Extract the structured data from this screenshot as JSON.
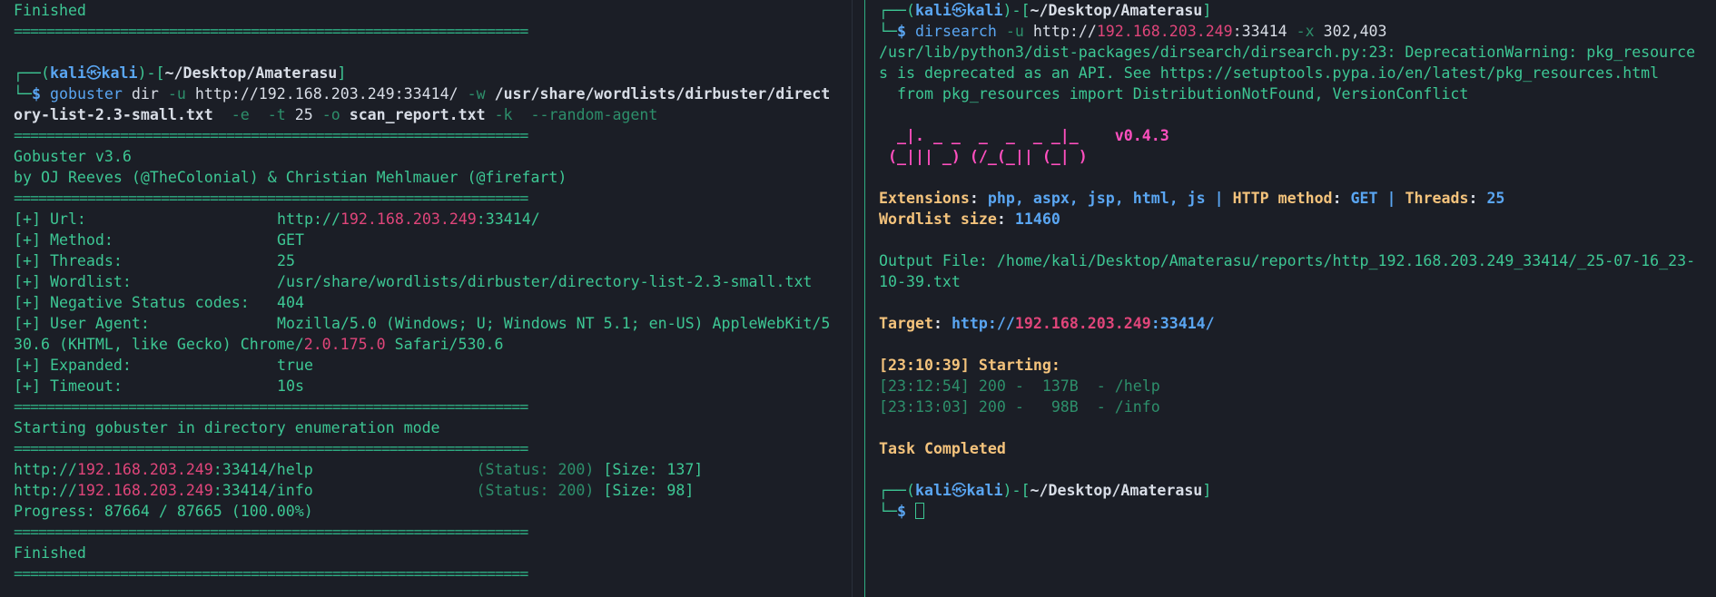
{
  "left": {
    "top_finished": "Finished",
    "separator": "===============================================================",
    "prompt": {
      "user": "kali",
      "host": "kali",
      "symbol": "㉿",
      "path": "~/Desktop/Amaterasu"
    },
    "command": {
      "tool": "gobuster",
      "sub": "dir",
      "u_flag": "-u",
      "url": "http://192.168.203.249:33414/",
      "w_flag": "-w",
      "wordlist_part1": "/usr/share/wordlists/dirbuster/direct",
      "wordlist_part2": "ory-list-2.3-small.txt",
      "e_flag": "-e",
      "t_flag": "-t",
      "t_value": "25",
      "o_flag": "-o",
      "output": "scan_report.txt",
      "k_flag": "-k",
      "random_agent": "--random-agent"
    },
    "banner_1": "Gobuster v3.6",
    "banner_2": "by OJ Reeves (@TheColonial) & Christian Mehlmauer (@firefart)",
    "config": {
      "url_label": "[+] Url:",
      "url_prefix": "http://",
      "url_ip": "192.168.203.249",
      "url_suffix": ":33414/",
      "method_label": "[+] Method:",
      "method_value": "GET",
      "threads_label": "[+] Threads:",
      "threads_value": "25",
      "wordlist_label": "[+] Wordlist:",
      "wordlist_value": "/usr/share/wordlists/dirbuster/directory-list-2.3-small.txt",
      "negative_label": "[+] Negative Status codes:",
      "negative_value": "404",
      "ua_label": "[+] User Agent:",
      "ua_value_1": "Mozilla/5.0 (Windows; U; Windows NT 5.1; en-US) AppleWebKit/5",
      "ua_value_2a": "30.6 (KHTML, like Gecko) Chrome/",
      "ua_value_2b": "2.0.175.0",
      "ua_value_2c": " Safari/530.6",
      "expanded_label": "[+] Expanded:",
      "expanded_value": "true",
      "timeout_label": "[+] Timeout:",
      "timeout_value": "10s"
    },
    "starting_text": "Starting gobuster in directory enumeration mode",
    "results": [
      {
        "prefix": "http://",
        "ip": "192.168.203.249",
        "path": ":33414/help",
        "status": "(Status: 200)",
        "size": "[Size: 137]"
      },
      {
        "prefix": "http://",
        "ip": "192.168.203.249",
        "path": ":33414/info",
        "status": "(Status: 200)",
        "size": "[Size: 98]"
      }
    ],
    "progress": "Progress: 87664 / 87665 (100.00%)",
    "bottom_finished": "Finished"
  },
  "right": {
    "prompt": {
      "user": "kali",
      "host": "kali",
      "symbol": "㉿",
      "path": "~/Desktop/Amaterasu"
    },
    "command": {
      "tool": "dirsearch",
      "u_flag": "-u",
      "url_prefix": "http://",
      "ip": "192.168.203.249",
      "url_suffix": ":33414",
      "x_flag": "-x",
      "x_value": "302,403"
    },
    "warning_1": "/usr/lib/python3/dist-packages/dirsearch/dirsearch.py:23: DeprecationWarning: pkg_resource",
    "warning_2": "s is deprecated as an API. See https://setuptools.pypa.io/en/latest/pkg_resources.html",
    "warning_3": "  from pkg_resources import DistributionNotFound, VersionConflict",
    "logo_1": "  _|. _ _  _  _  _ _|_",
    "logo_2": " (_||| _) (/_(_|| (_| )",
    "version": "v0.4.3",
    "ext_label": "Extensions",
    "ext_value": "php, aspx, jsp, html, js",
    "method_label": "HTTP method",
    "method_value": "GET",
    "threads_label": "Threads",
    "threads_value": "25",
    "wordlist_label": "Wordlist size",
    "wordlist_value": "11460",
    "output_line_1": "Output File: /home/kali/Desktop/Amaterasu/reports/http_192.168.203.249_33414/_25-07-16_23-",
    "output_line_2": "10-39.txt",
    "target_label": "Target",
    "target_prefix": "http://",
    "target_ip": "192.168.203.249",
    "target_suffix": ":33414/",
    "starting": "[23:10:39] Starting:",
    "results": [
      "[23:12:54] 200 -  137B  - /help",
      "[23:13:03] 200 -   98B  - /info"
    ],
    "task_completed": "Task Completed"
  }
}
